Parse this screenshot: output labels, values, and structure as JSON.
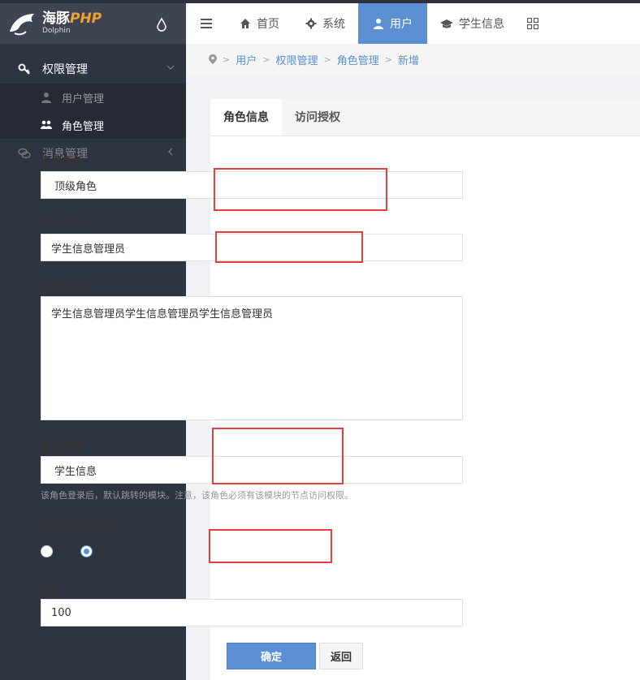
{
  "brand": {
    "name_cn": "海豚",
    "name_php": "PHP",
    "name_en": "Dolphin"
  },
  "sidebar": {
    "menu": [
      {
        "label": "权限管理",
        "open": true,
        "children": [
          {
            "label": "用户管理"
          },
          {
            "label": "角色管理"
          }
        ]
      },
      {
        "label": "消息管理",
        "open": false
      }
    ]
  },
  "topnav": {
    "tabs": [
      {
        "label": "首页",
        "icon": "home-icon"
      },
      {
        "label": "系统",
        "icon": "gear-icon"
      },
      {
        "label": "用户",
        "icon": "user-icon",
        "active": true
      },
      {
        "label": "学生信息",
        "icon": "graduation-cap-icon"
      }
    ]
  },
  "breadcrumb": {
    "items": [
      "用户",
      "权限管理",
      "角色管理",
      "新增"
    ]
  },
  "form": {
    "tabs": [
      "角色信息",
      "访问授权"
    ],
    "parent_role": {
      "label": "所属角色",
      "value": "顶级角色"
    },
    "role_name": {
      "label": "角色名称",
      "value": "学生信息管理员"
    },
    "role_desc": {
      "label": "角色描述",
      "value": "学生信息管理员学生信息管理员学生信息管理员"
    },
    "default_module": {
      "label": "默认模块",
      "value": "学生信息",
      "help": "该角色登录后，默认跳转的模块。注意，该角色必须有该模块的节点访问权限。"
    },
    "login_admin": {
      "label": "是否可登录后台",
      "options": [
        "否",
        "是"
      ],
      "selected": "是"
    },
    "sort": {
      "label": "排序",
      "value": "100"
    },
    "submit_label": "确定",
    "back_label": "返回"
  },
  "colors": {
    "accent": "#5c90d2",
    "sidebar": "#2f3441",
    "highlight": "#e53e3e"
  }
}
